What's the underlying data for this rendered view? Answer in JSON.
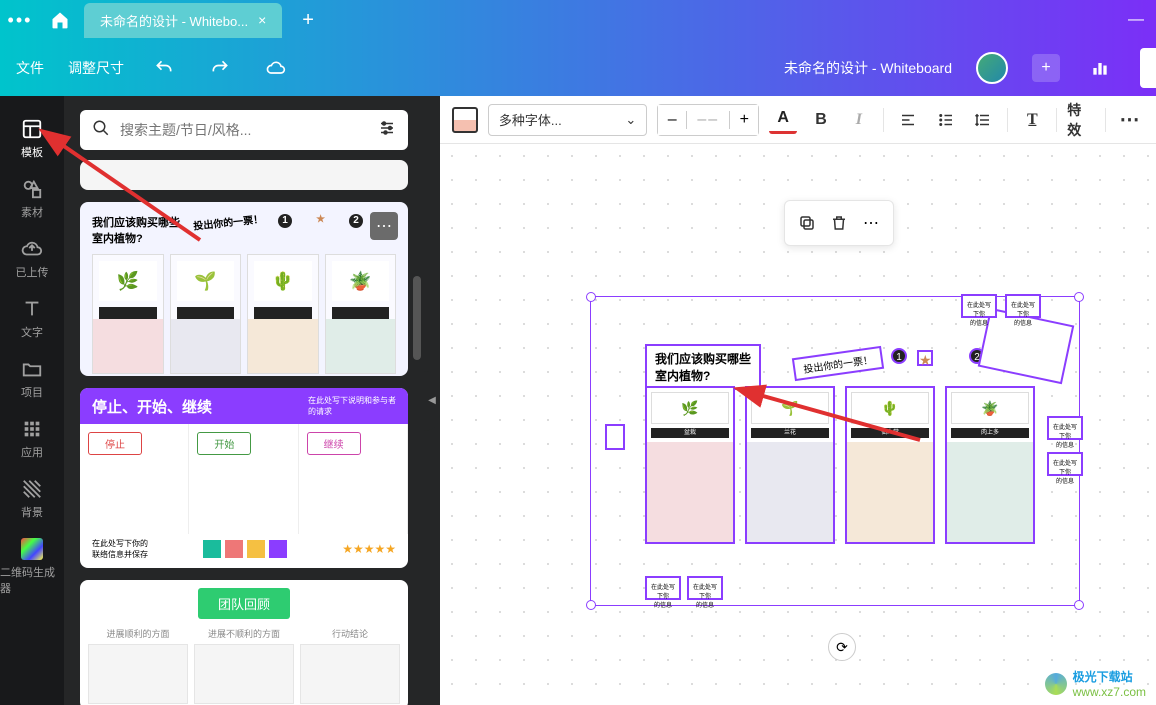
{
  "titlebar": {
    "tab_label": "未命名的设计 - Whitebo...",
    "close": "×",
    "plus": "+",
    "minimize": "—"
  },
  "toolbar": {
    "file": "文件",
    "resize": "调整尺寸",
    "title": "未命名的设计 - Whiteboard",
    "add": "+"
  },
  "rail": {
    "templates": "模板",
    "elements": "素材",
    "uploads": "已上传",
    "text": "文字",
    "projects": "项目",
    "apps": "应用",
    "background": "背景",
    "qrcode": "二维码生成器"
  },
  "panel": {
    "search_placeholder": "搜索主题/节日/风格...",
    "tpl2": {
      "title": "我们应该购买哪些\n室内植物?",
      "vote": "投出你的一票！",
      "num1": "1",
      "num2": "2",
      "more": "⋯"
    },
    "tpl3": {
      "title": "停止、开始、继续",
      "sub": "在此处写下说明和参与者\n的请求",
      "col1": "停止",
      "col2": "开始",
      "col3": "继续",
      "foot": "在此处写下你的\n联络信息并保存",
      "stars": "★★★★★"
    },
    "tpl4": {
      "btn": "团队回顾",
      "c1": "进展顺利的方面",
      "c2": "进展不顺利的方面",
      "c3": "行动结论"
    }
  },
  "ctoolbar": {
    "font": "多种字体...",
    "size": "––",
    "minus": "–",
    "plus": "+",
    "A": "A",
    "B": "B",
    "I": "I",
    "fx": "特效",
    "more": "⋯"
  },
  "floatbar": {
    "more": "⋯"
  },
  "canvas": {
    "title": "我们应该购买哪些\n室内植物?",
    "vote": "投出你的一票！",
    "num1": "1",
    "num2": "2",
    "star": "★",
    "card_labels": [
      "盆栽",
      "兰花",
      "仙人掌",
      "肉上多"
    ],
    "sticky": "在此处写下你\n的信息"
  },
  "watermark": {
    "t1": "极光下载站",
    "t2": "www.xz7.com"
  },
  "colors": {
    "accent": "#8b3dff",
    "arrow": "#e03030"
  }
}
